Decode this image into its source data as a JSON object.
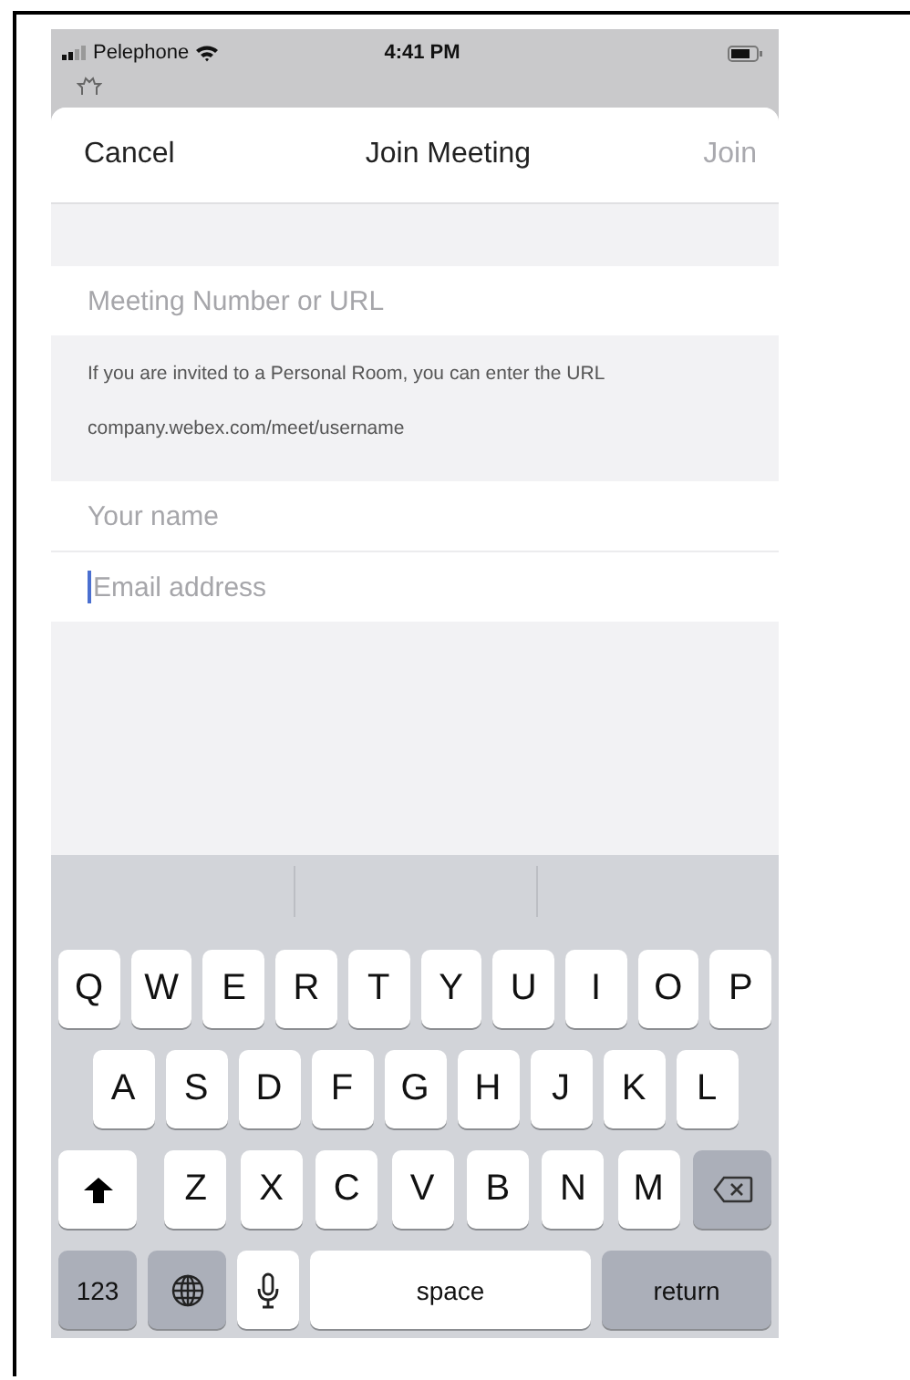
{
  "status_bar": {
    "carrier": "Pelephone",
    "time": "4:41 PM"
  },
  "header": {
    "cancel": "Cancel",
    "title": "Join Meeting",
    "join": {
      "label": "Join",
      "disabled": true
    }
  },
  "meeting_field": {
    "placeholder": "Meeting Number or URL",
    "focused": false
  },
  "help_text": [
    "If you are invited to a Personal Room, you can enter the URL",
    "company.webex.com/meet/username"
  ],
  "identity_fields": [
    {
      "placeholder": "Your name",
      "focused": false
    },
    {
      "placeholder": "Email address",
      "focused": true
    }
  ],
  "keyboard": {
    "key_rows": [
      {
        "keys": [
          {
            "kind": "letter",
            "label": "Q"
          },
          {
            "kind": "letter",
            "label": "W"
          },
          {
            "kind": "letter",
            "label": "E"
          },
          {
            "kind": "letter",
            "label": "R"
          },
          {
            "kind": "letter",
            "label": "T"
          },
          {
            "kind": "letter",
            "label": "Y"
          },
          {
            "kind": "letter",
            "label": "U"
          },
          {
            "kind": "letter",
            "label": "I"
          },
          {
            "kind": "letter",
            "label": "O"
          },
          {
            "kind": "letter",
            "label": "P"
          }
        ]
      },
      {
        "keys": [
          {
            "kind": "letter",
            "label": "A"
          },
          {
            "kind": "letter",
            "label": "S"
          },
          {
            "kind": "letter",
            "label": "D"
          },
          {
            "kind": "letter",
            "label": "F"
          },
          {
            "kind": "letter",
            "label": "G"
          },
          {
            "kind": "letter",
            "label": "H"
          },
          {
            "kind": "letter",
            "label": "J"
          },
          {
            "kind": "letter",
            "label": "K"
          },
          {
            "kind": "letter",
            "label": "L"
          }
        ]
      },
      {
        "keys": [
          {
            "kind": "shift"
          },
          {
            "kind": "letter",
            "label": "Z"
          },
          {
            "kind": "letter",
            "label": "X"
          },
          {
            "kind": "letter",
            "label": "C"
          },
          {
            "kind": "letter",
            "label": "V"
          },
          {
            "kind": "letter",
            "label": "B"
          },
          {
            "kind": "letter",
            "label": "N"
          },
          {
            "kind": "letter",
            "label": "M"
          },
          {
            "kind": "backspace"
          }
        ]
      },
      {
        "keys": [
          {
            "kind": "mode",
            "label": "123"
          },
          {
            "kind": "globe"
          },
          {
            "kind": "mic"
          },
          {
            "kind": "space",
            "label": "space"
          },
          {
            "kind": "return",
            "label": "return"
          }
        ]
      }
    ]
  }
}
